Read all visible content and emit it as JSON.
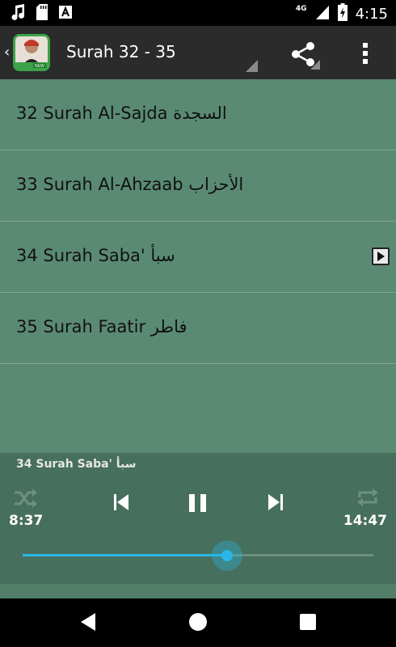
{
  "status_bar": {
    "network": "4G",
    "time": "4:15",
    "icons": [
      "music-note-icon",
      "sd-card-icon",
      "font-app-icon",
      "signal-icon",
      "battery-charging-icon"
    ]
  },
  "action_bar": {
    "title": "Surah 32 - 35",
    "icons": [
      "back-chevron-icon",
      "app-logo",
      "share-icon",
      "overflow-menu-icon"
    ]
  },
  "surahs": [
    {
      "label": "32 Surah Al-Sajda السجدة",
      "playing": false
    },
    {
      "label": "33 Surah Al-Ahzaab الأحزاب",
      "playing": false
    },
    {
      "label": "34 Surah Saba' سبأ",
      "playing": true
    },
    {
      "label": "35 Surah Faatir فاطر",
      "playing": false
    }
  ],
  "player": {
    "now_playing": "34 Surah Saba' سبأ",
    "elapsed": "8:37",
    "total": "14:47",
    "progress_fraction": 0.583,
    "accent_color": "#29b6e8",
    "controls": [
      "shuffle-icon",
      "previous-icon",
      "pause-icon",
      "next-icon",
      "repeat-icon"
    ]
  },
  "nav_bar": {
    "icons": [
      "back-triangle-icon",
      "home-circle-icon",
      "recents-square-icon"
    ]
  }
}
